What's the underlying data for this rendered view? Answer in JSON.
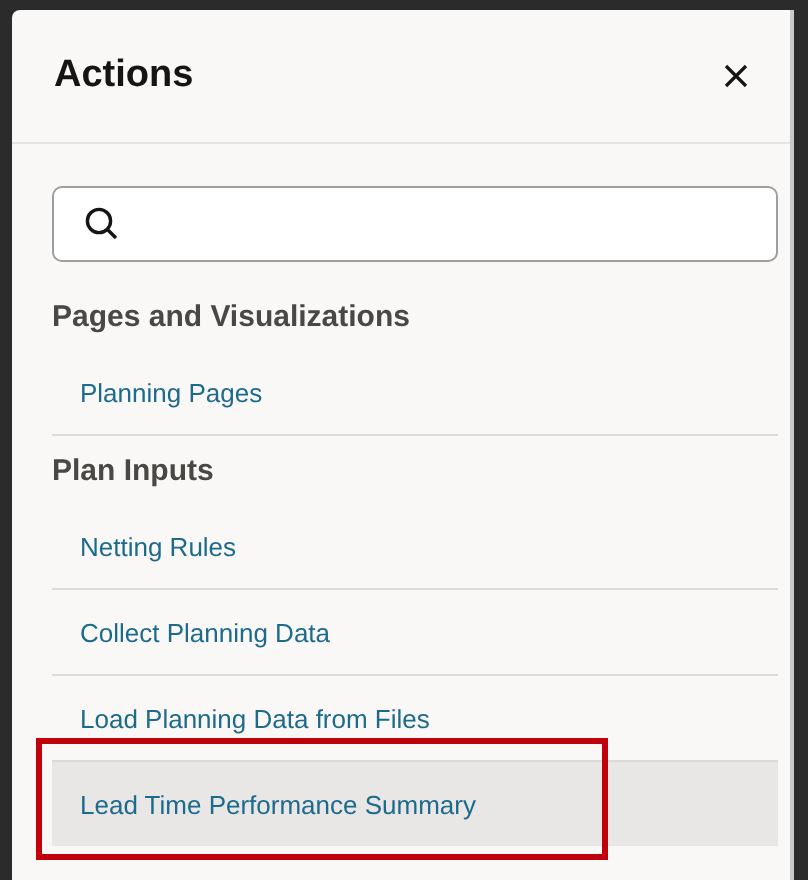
{
  "panel": {
    "title": "Actions"
  },
  "sections": [
    {
      "heading": "Pages and Visualizations",
      "items": [
        {
          "label": "Planning Pages",
          "selected": false,
          "callout": false
        }
      ]
    },
    {
      "heading": "Plan Inputs",
      "items": [
        {
          "label": "Netting Rules",
          "selected": false,
          "callout": false
        },
        {
          "label": "Collect Planning Data",
          "selected": false,
          "callout": false
        },
        {
          "label": "Load Planning Data from Files",
          "selected": false,
          "callout": false
        },
        {
          "label": "Lead Time Performance Summary",
          "selected": true,
          "callout": true
        }
      ]
    }
  ]
}
